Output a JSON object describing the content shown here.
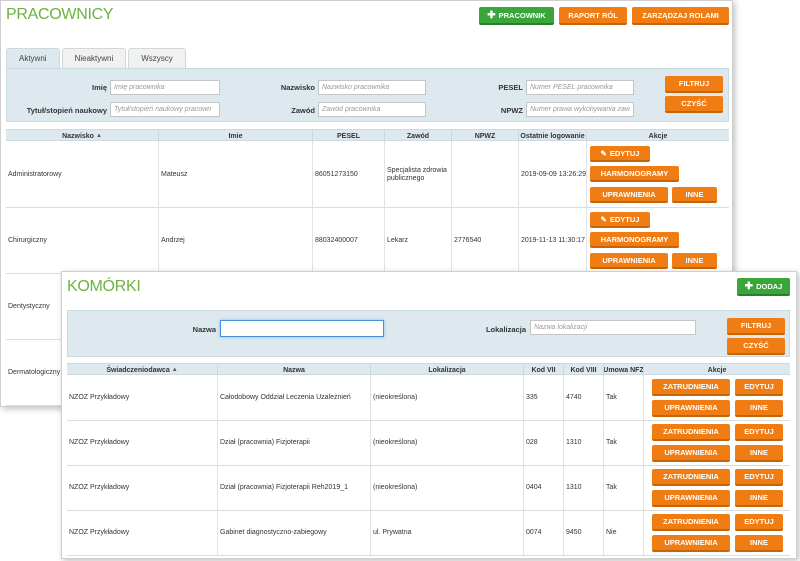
{
  "pracownicy": {
    "title": "PRACOWNICY",
    "buttons": {
      "add": "PRACOWNIK",
      "report": "RAPORT RÓL",
      "manage": "ZARZĄDZAJ ROLAMI"
    },
    "tabs": [
      "Aktywni",
      "Nieaktywni",
      "Wszyscy"
    ],
    "filters": {
      "imie_label": "Imię",
      "imie_ph": "Imię pracownika",
      "nazwisko_label": "Nazwisko",
      "nazwisko_ph": "Nazwisko pracownika",
      "pesel_label": "PESEL",
      "pesel_ph": "Numer PESEL pracownika",
      "tytul_label": "Tytuł/stopień naukowy",
      "tytul_ph": "Tytuł/stopień naukowy pracown",
      "zawod_label": "Zawód",
      "zawod_ph": "Zawód pracownika",
      "npwz_label": "NPWZ",
      "npwz_ph": "Numer prawa wykonywania zaw",
      "filter_btn": "FILTRUJ",
      "clear_btn": "CZYŚĆ"
    },
    "columns": [
      "Nazwisko",
      "Imie",
      "PESEL",
      "Zawód",
      "NPWZ",
      "Ostatnie logowanie",
      "Akcje"
    ],
    "actions": {
      "edit": "EDYTUJ",
      "schedules": "HARMONOGRAMY",
      "permissions": "UPRAWNIENIA",
      "other": "INNE"
    },
    "rows": [
      {
        "nazwisko": "Administratorowy",
        "imie": "Mateusz",
        "pesel": "86051273150",
        "zawod": "Specjalista zdrowia publicznego",
        "npwz": "",
        "login": "2019-09-09 13:26:29"
      },
      {
        "nazwisko": "Chirurgiczny",
        "imie": "Andrzej",
        "pesel": "88032400007",
        "zawod": "Lekarz",
        "npwz": "2776540",
        "login": "2019-11-13 11:30:17"
      },
      {
        "nazwisko": "Dentystyczny"
      },
      {
        "nazwisko": "Dermatologiczny"
      }
    ]
  },
  "komorki": {
    "title": "KOMÓRKI",
    "add_btn": "DODAJ",
    "filters": {
      "nazwa_label": "Nazwa",
      "nazwa_value": "",
      "lok_label": "Lokalizacja",
      "lok_ph": "Nazwa lokalizacji",
      "filter_btn": "FILTRUJ",
      "clear_btn": "CZYŚĆ"
    },
    "columns": [
      "Świadczeniodawca",
      "Nazwa",
      "Lokalizacja",
      "Kod VII",
      "Kod VIII",
      "Umowa NFZ",
      "Akcje"
    ],
    "actions": {
      "employment": "ZATRUDNIENIA",
      "edit": "EDYTUJ",
      "permissions": "UPRAWNIENIA",
      "other": "INNE"
    },
    "rows": [
      {
        "provider": "NZOZ Przykładowy",
        "name": "Całodobowy Oddział Leczenia Uzależnień",
        "loc": "(nieokreślona)",
        "k7": "335",
        "k8": "4740",
        "nfz": "Tak"
      },
      {
        "provider": "NZOZ Przykładowy",
        "name": "Dział (pracownia) Fizjoterapii",
        "loc": "(nieokreślona)",
        "k7": "028",
        "k8": "1310",
        "nfz": "Tak"
      },
      {
        "provider": "NZOZ Przykładowy",
        "name": "Dział (pracownia) Fizjoterapii Reh2019_1",
        "loc": "(nieokreślona)",
        "k7": "0404",
        "k8": "1310",
        "nfz": "Tak"
      },
      {
        "provider": "NZOZ Przykładowy",
        "name": "Gabinet diagnostyczno-zabiegowy",
        "loc": "ul. Prywatna",
        "k7": "0074",
        "k8": "9450",
        "nfz": "Nie"
      }
    ]
  },
  "icons": {
    "plus": "plus-icon",
    "pencil": "pencil-icon",
    "sort": "sort-up-icon"
  },
  "colors": {
    "accent_green": "#6cb33f",
    "btn_orange": "#f07c14",
    "btn_green": "#3aa53a",
    "filter_bg": "#dde9ef"
  }
}
